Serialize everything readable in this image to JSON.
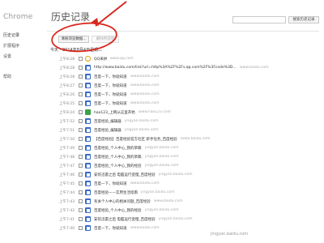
{
  "app": {
    "brand": "Chrome",
    "title": "历史记录"
  },
  "sidebar": {
    "items": [
      {
        "label": "历史记录",
        "active": true
      },
      {
        "label": "扩展程序",
        "active": false
      },
      {
        "label": "设置",
        "active": false
      },
      {
        "label": "帮助",
        "active": false
      }
    ]
  },
  "search": {
    "placeholder": "",
    "button_label": "搜索历史记录"
  },
  "actions": {
    "clear_label": "清除浏览数据...",
    "remove_label": "删除所选项"
  },
  "date_header": "今天 - 2014年8月4日星期二",
  "entries": [
    {
      "time": "上午8:28",
      "icon": "qq-icon",
      "title": "QQ采拼",
      "domain": "www.qq.com"
    },
    {
      "time": "上午8:28",
      "icon": "document-icon",
      "title": "http://www.baidu.com/link?url=http%3A%2F%2Fv.qq.com%2F%3Fcode%3D...",
      "domain": "www.baidu.com"
    },
    {
      "time": "上午8:28",
      "icon": "document-icon",
      "title": "百度一下，你就知道",
      "domain": "www.baidu.com"
    },
    {
      "time": "上午8:27",
      "icon": "document-icon",
      "title": "百度一下，你就知道",
      "domain": "www.baidu.com"
    },
    {
      "time": "上午8:26",
      "icon": "document-icon",
      "title": "百度一下，你就知道",
      "domain": "www.baidu.com"
    },
    {
      "time": "上午8:25",
      "icon": "document-icon",
      "title": "百度一下，你就知道",
      "domain": "www.baidu.com"
    },
    {
      "time": "上午8:24",
      "icon": "hao-icon",
      "title": "hao123_上网从这里开始",
      "domain": "www.hao123.com"
    },
    {
      "time": "上午7:52",
      "icon": "document-icon",
      "title": "百度经验_编辑器",
      "domain": "jingyan.baidu.com"
    },
    {
      "time": "上午7:51",
      "icon": "document-icon",
      "title": "百度经验_编辑器",
      "domain": "jingyan.baidu.com"
    },
    {
      "time": "上午7:50",
      "icon": "document-icon",
      "title": "【百度经验】百度经验官方社区 新手任务_百度经验",
      "domain": "tieba.baidu.com"
    },
    {
      "time": "上午7:49",
      "icon": "document-icon",
      "title": "百度经验_个人中心_我的草稿",
      "domain": "jingyan.baidu.com"
    },
    {
      "time": "上午7:48",
      "icon": "document-icon",
      "title": "百度经验_个人中心_我的草稿",
      "domain": "jingyan.baidu.com"
    },
    {
      "time": "上午7:47",
      "icon": "document-icon",
      "title": "百度经验_个人中心_我的经验",
      "domain": "jingyan.baidu.com"
    },
    {
      "time": "上午7:46",
      "icon": "document-icon",
      "title": "安装迅雷之后 电脑运行变慢_百度经验",
      "domain": "jingyan.baidu.com"
    },
    {
      "time": "上午7:45",
      "icon": "document-icon",
      "title": "百度一下，你就知道",
      "domain": "www.baidu.com"
    },
    {
      "time": "上午7:44",
      "icon": "document-icon",
      "title": "百度经验——实用生活指南",
      "domain": "jingyan.baidu.com"
    },
    {
      "time": "上午7:43",
      "icon": "document-icon",
      "title": "有关个人中心的相关问题_百度经验",
      "domain": "www.baidu.com"
    },
    {
      "time": "上午7:42",
      "icon": "document-icon",
      "title": "百度经验_个人中心_我的经验",
      "domain": "jingyan.baidu.com"
    },
    {
      "time": "上午7:41",
      "icon": "document-icon",
      "title": "安装迅雷之后 电脑运行变慢_百度经验",
      "domain": "jingyan.baidu.com"
    },
    {
      "time": "上午7:40",
      "icon": "document-icon",
      "title": "百度一下，你就知道",
      "domain": "www.baidu.com"
    }
  ],
  "footer": "jingyan.baidu.com",
  "colors": {
    "annotation": "#d9281e",
    "link_icon": "#3a6cc7"
  }
}
